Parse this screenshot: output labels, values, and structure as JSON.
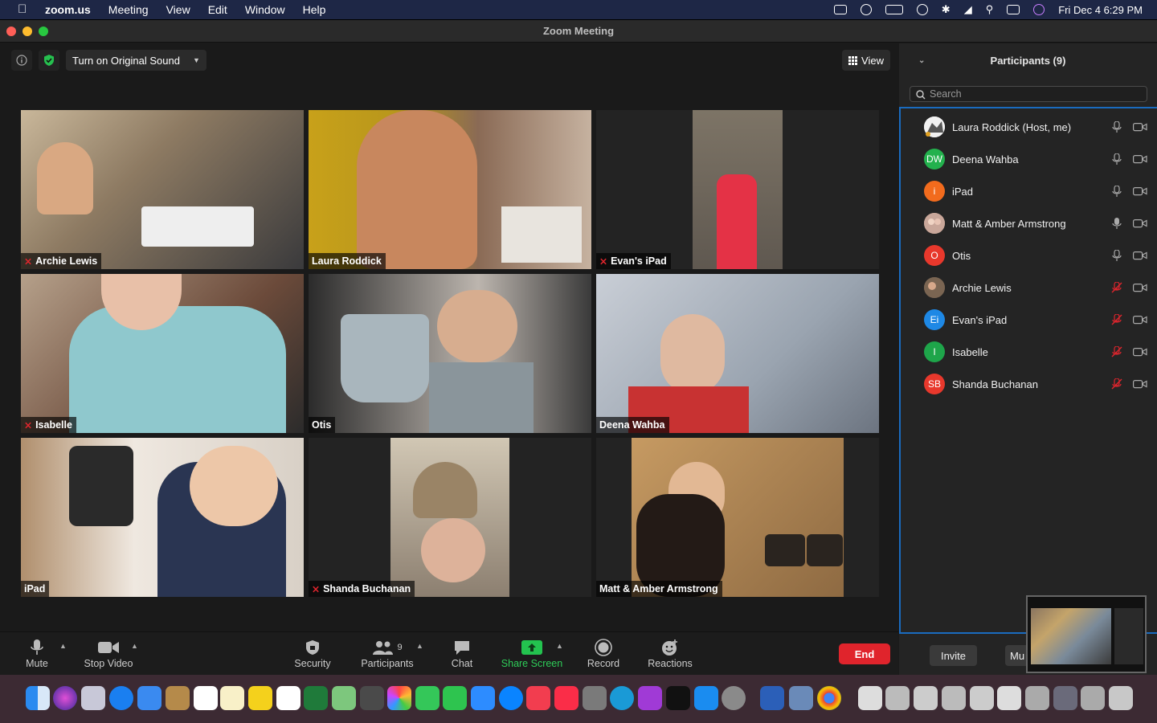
{
  "menubar": {
    "app": "zoom.us",
    "items": [
      "Meeting",
      "View",
      "Edit",
      "Window",
      "Help"
    ],
    "clock": "Fri Dec 4  6:29 PM"
  },
  "window": {
    "title": "Zoom Meeting"
  },
  "top_controls": {
    "original_sound": "Turn on Original Sound",
    "view": "View"
  },
  "tiles": [
    {
      "name": "Archie Lewis",
      "muted": true
    },
    {
      "name": "Laura Roddick",
      "muted": false
    },
    {
      "name": "Evan's iPad",
      "muted": true
    },
    {
      "name": "Isabelle",
      "muted": true
    },
    {
      "name": "Otis",
      "muted": false
    },
    {
      "name": "Deena Wahba",
      "muted": false
    },
    {
      "name": "iPad",
      "muted": false
    },
    {
      "name": "Shanda Buchanan",
      "muted": true
    },
    {
      "name": "Matt & Amber Armstrong",
      "muted": false
    }
  ],
  "toolbar": {
    "mute": "Mute",
    "stop_video": "Stop Video",
    "security": "Security",
    "participants": "Participants",
    "participants_count": "9",
    "chat": "Chat",
    "share_screen": "Share Screen",
    "record": "Record",
    "reactions": "Reactions",
    "end": "End"
  },
  "panel": {
    "title": "Participants (9)",
    "search_placeholder": "Search",
    "participants": [
      {
        "name": "Laura Roddick (Host, me)",
        "initials": "",
        "color": "#8a8a8a",
        "muted": false
      },
      {
        "name": "Deena Wahba",
        "initials": "DW",
        "color": "#23b14d",
        "muted": false
      },
      {
        "name": "iPad",
        "initials": "i",
        "color": "#f26b1d",
        "muted": false
      },
      {
        "name": "Matt & Amber Armstrong",
        "initials": "",
        "color": "#b08a7a",
        "muted": false
      },
      {
        "name": "Otis",
        "initials": "O",
        "color": "#e8382c",
        "muted": false
      },
      {
        "name": "Archie Lewis",
        "initials": "",
        "color": "#6a5a4a",
        "muted": true
      },
      {
        "name": "Evan's iPad",
        "initials": "Ei",
        "color": "#1e88e5",
        "muted": true
      },
      {
        "name": "Isabelle",
        "initials": "I",
        "color": "#1ea54a",
        "muted": true
      },
      {
        "name": "Shanda Buchanan",
        "initials": "SB",
        "color": "#e8382c",
        "muted": true
      }
    ],
    "invite": "Invite",
    "mute_all": "Mu"
  }
}
